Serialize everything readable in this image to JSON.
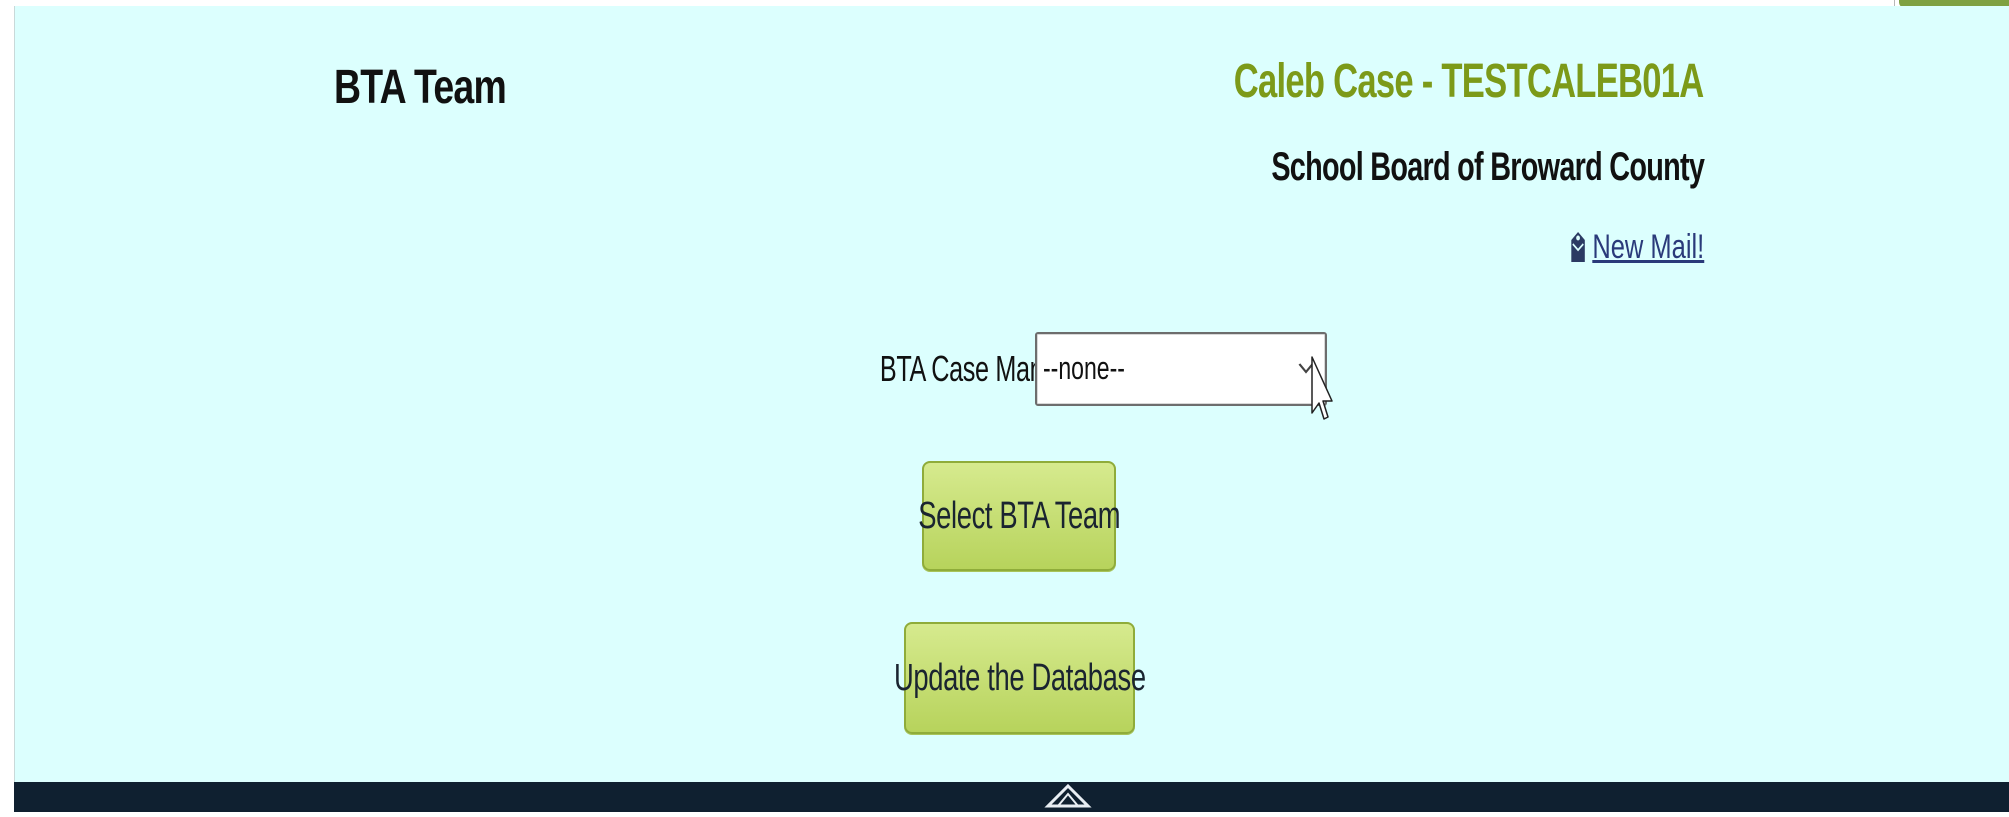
{
  "header": {
    "page_title": "BTA Team",
    "user_name": "Caleb Case - TESTCALEB01A",
    "organization": "School Board of Broward County",
    "mail_link": "New Mail!",
    "mail_icon": "mail-icon"
  },
  "form": {
    "case_manager_label": "BTA Case Manager:",
    "case_manager_value": "--none--",
    "select_button": "Select BTA Team",
    "update_button": "Update the Database"
  },
  "colors": {
    "page_background": "#dcfffe",
    "accent_green": "#7c9a19",
    "button_green": "#c6df74",
    "footer": "#0f2030"
  }
}
